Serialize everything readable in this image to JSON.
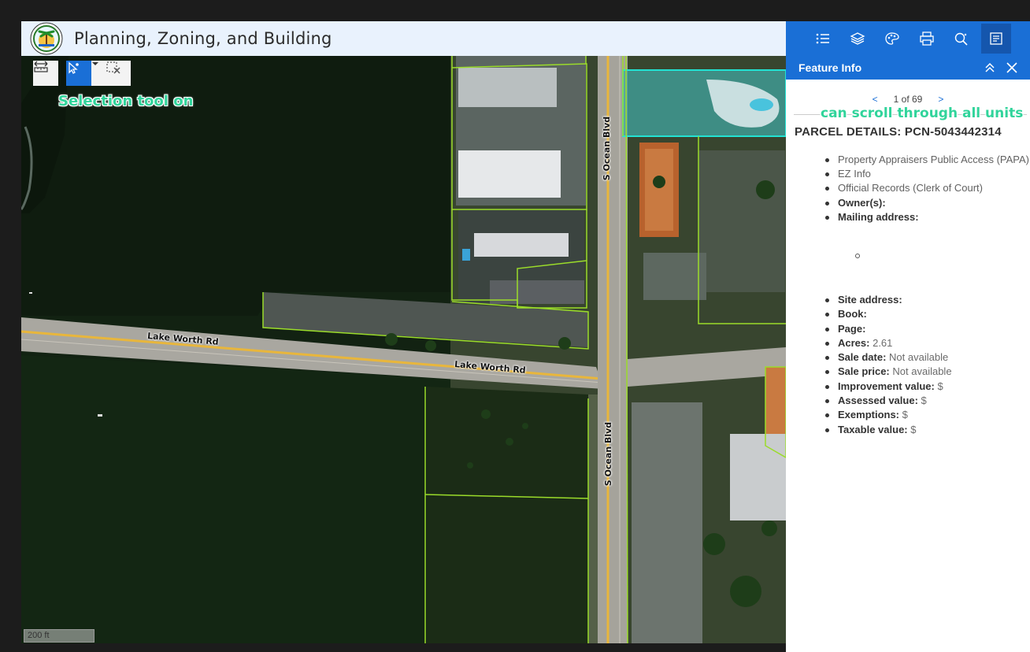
{
  "header": {
    "title": "Planning, Zoning, and Building",
    "logo_icon": "palm-beach-county-seal"
  },
  "map": {
    "annotation": "Selection tool on",
    "scale_label": "200 ft",
    "roads": {
      "lake_worth_1": "Lake Worth Rd",
      "lake_worth_2": "Lake Worth Rd",
      "ocean_blvd_1": "S Ocean Blvd",
      "ocean_blvd_2": "S Ocean Blvd"
    },
    "tools": [
      "measure-icon",
      "select-pointer-icon",
      "dropdown-icon",
      "clear-selection-icon"
    ],
    "parcel_outline_color": "#9bdc2a",
    "selected_outline_color": "#22e3d3"
  },
  "toolbar": {
    "icons": [
      "legend-list-icon",
      "layers-icon",
      "basemap-palette-icon",
      "print-icon",
      "search-icon",
      "feature-info-icon"
    ],
    "accent": "#1a6fd6"
  },
  "panel": {
    "title": "Feature Info",
    "pager": {
      "prev": "<",
      "text": "1 of 69",
      "next": ">"
    },
    "annotation": "can scroll through all units",
    "parcel_title": "PARCEL DETAILS: PCN-5043442314",
    "links": [
      {
        "text": "Property Appraisers Public Access (PAPA)"
      },
      {
        "text": "EZ Info"
      },
      {
        "text": "Official Records (Clerk of Court)"
      }
    ],
    "owner_label": "Owner(s):",
    "mailing_label": "Mailing address:",
    "details": [
      {
        "label": "Site address:",
        "value": ""
      },
      {
        "label": "Book:",
        "value": ""
      },
      {
        "label": "Page:",
        "value": ""
      },
      {
        "label": "Acres:",
        "value": "2.61"
      },
      {
        "label": "Sale date:",
        "value": "Not available"
      },
      {
        "label": "Sale price:",
        "value": "Not available"
      },
      {
        "label": "Improvement value:",
        "value": "$"
      },
      {
        "label": "Assessed value:",
        "value": "$"
      },
      {
        "label": "Exemptions:",
        "value": "$"
      },
      {
        "label": "Taxable value:",
        "value": "$"
      }
    ]
  }
}
